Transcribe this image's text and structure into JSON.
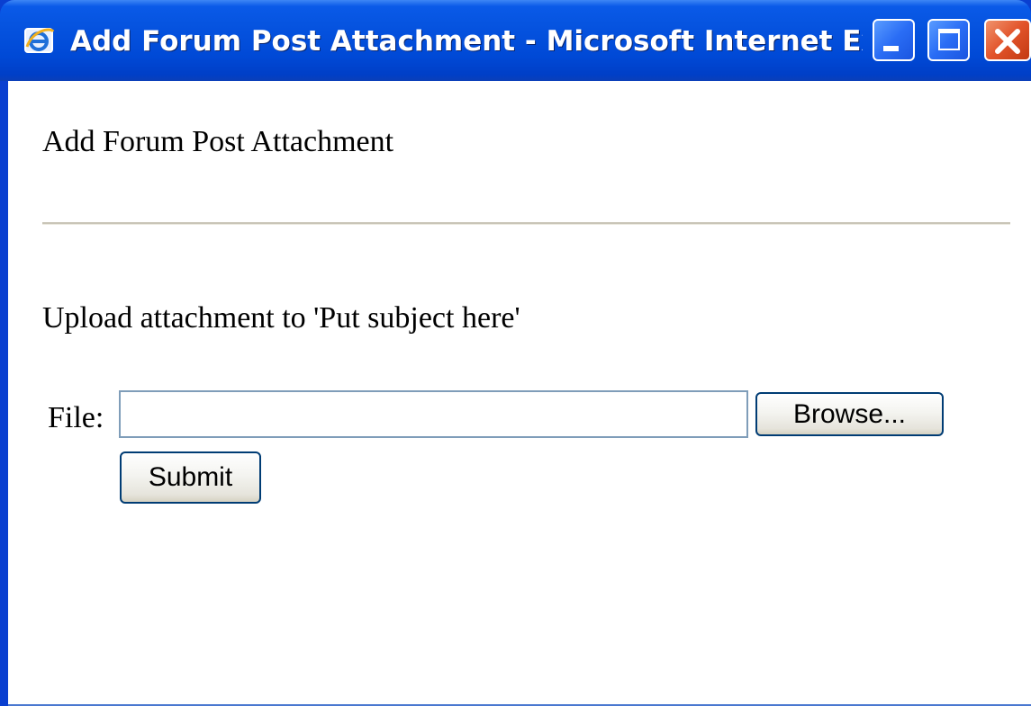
{
  "window": {
    "title": "Add Forum Post Attachment - Microsoft Internet Ex...",
    "icon": "internet-explorer-icon",
    "controls": {
      "minimize_icon": "minimize-icon",
      "maximize_icon": "maximize-icon",
      "close_icon": "close-icon"
    }
  },
  "page": {
    "heading": "Add Forum Post Attachment",
    "upload_text": "Upload attachment to 'Put subject here'",
    "form": {
      "file_label": "File:",
      "file_value": "",
      "browse_label": "Browse...",
      "submit_label": "Submit"
    }
  },
  "colors": {
    "titlebar": "#0654e0",
    "close_button": "#e2532a",
    "button_border": "#003c74",
    "input_border": "#7f9db9"
  }
}
